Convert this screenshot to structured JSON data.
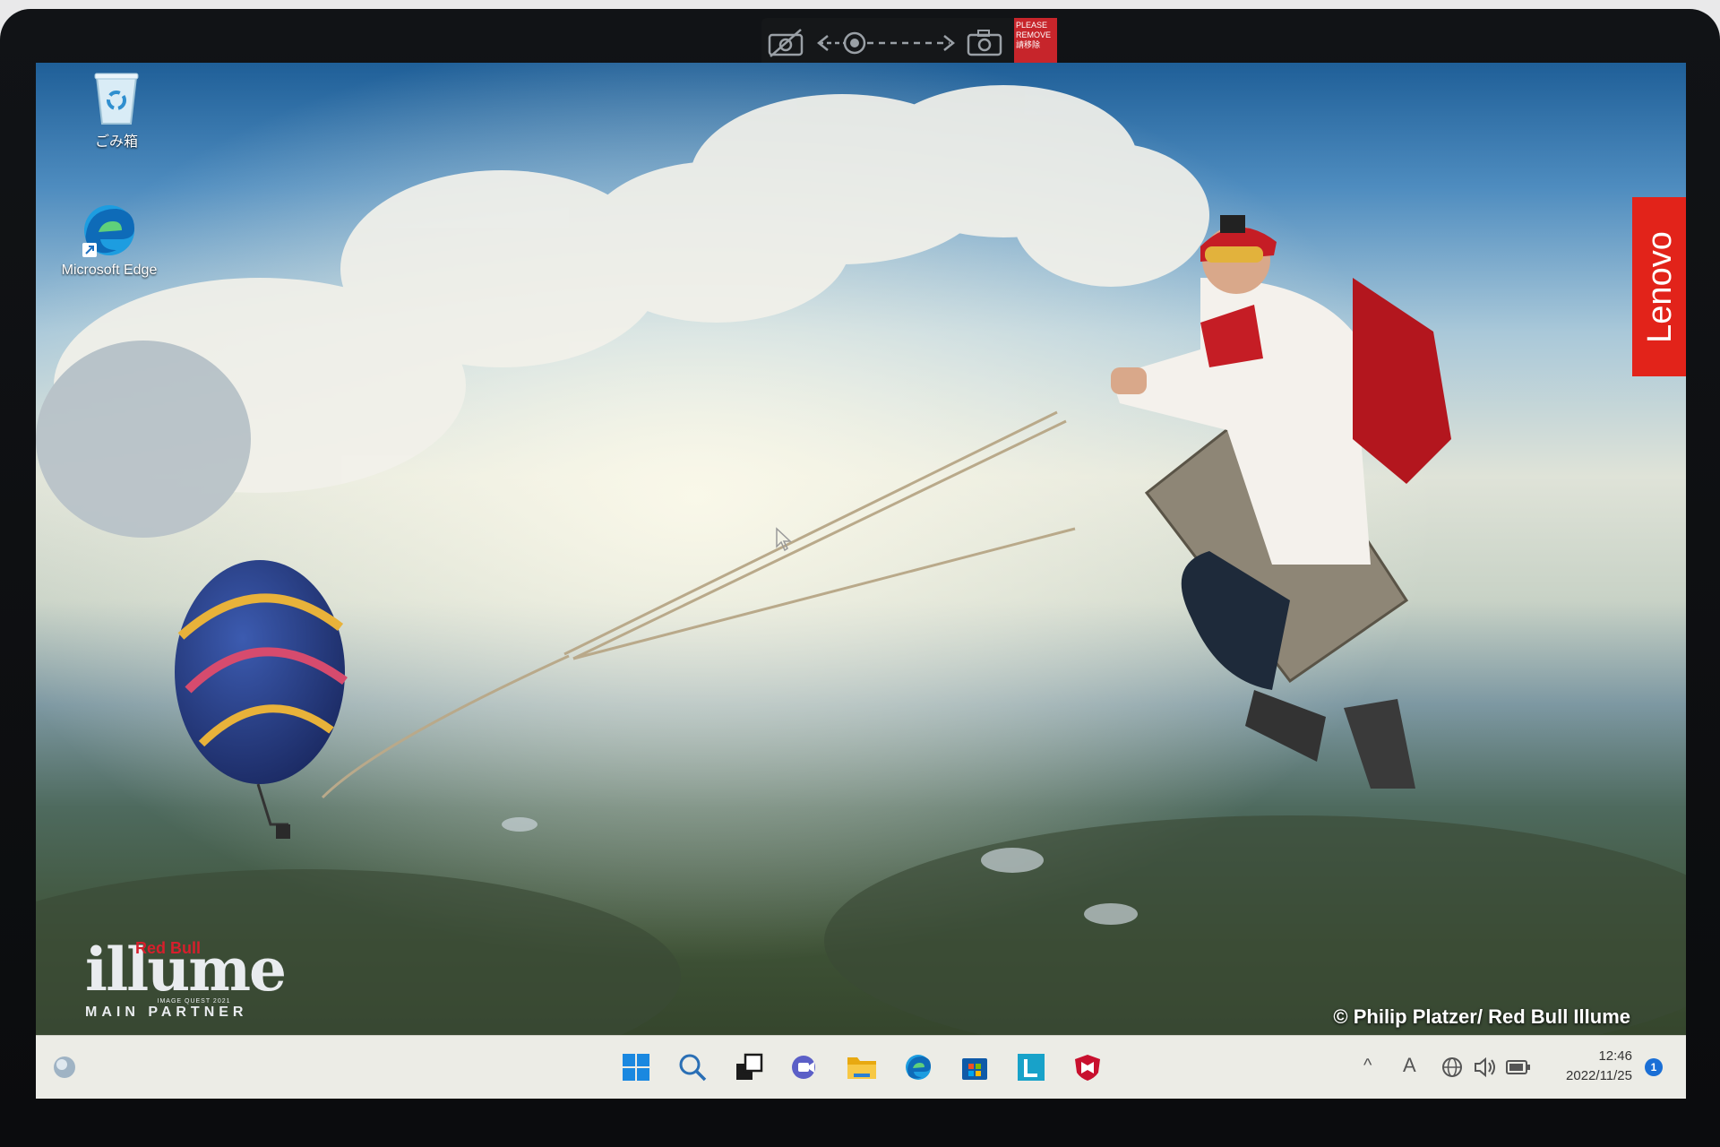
{
  "camera_shutter": {
    "icons": [
      "camera-off-icon",
      "slider-icon",
      "camera-icon"
    ],
    "tag_text": "PLEASE REMOVE 請移除"
  },
  "desktop": {
    "icons": [
      {
        "label": "ごみ箱",
        "icon": "recycle-bin-icon"
      },
      {
        "label": "Microsoft Edge",
        "icon": "edge-icon"
      }
    ]
  },
  "wallpaper": {
    "brand_tag": "Lenovo",
    "illume": {
      "brand": "Red Bull",
      "title": "illume",
      "subtitle": "IMAGE QUEST 2021",
      "partner": "MAIN PARTNER"
    },
    "credit": "© Philip Platzer/ Red Bull Illume"
  },
  "taskbar": {
    "widgets_icon": "widgets-icon",
    "pinned": [
      "start-icon",
      "search-icon",
      "task-view-icon",
      "chat-icon",
      "file-explorer-icon",
      "edge-icon",
      "store-icon",
      "lenovo-vantage-icon",
      "mcafee-icon"
    ],
    "tray": {
      "chevron": "^",
      "ime": "A",
      "icons": [
        "network-icon",
        "volume-icon",
        "battery-icon"
      ]
    },
    "clock": {
      "time": "12:46",
      "date": "2022/11/25"
    },
    "notifications": "1"
  },
  "colors": {
    "lenovo_red": "#e2231a",
    "taskbar_bg": "#ecece6",
    "badge_blue": "#1a6fd6"
  }
}
